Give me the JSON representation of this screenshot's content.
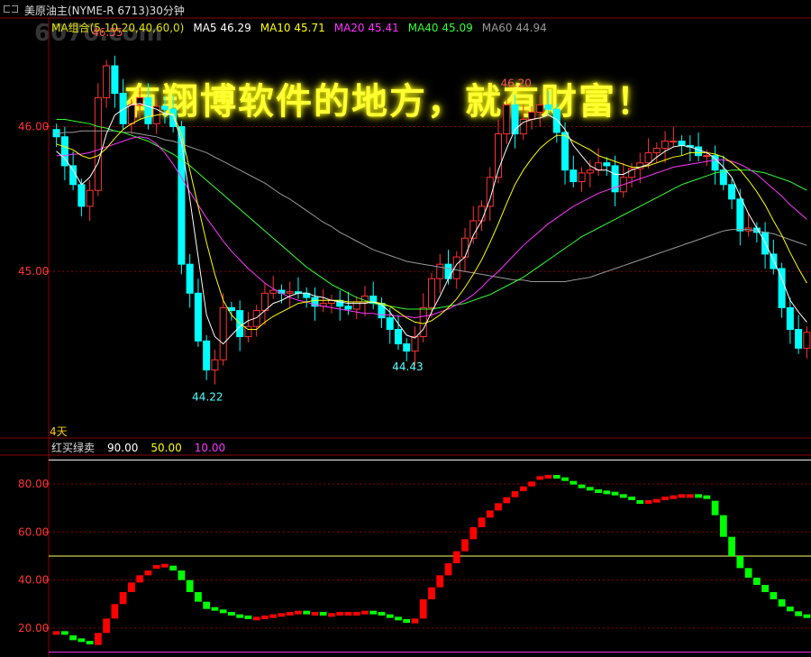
{
  "title": "美原油主(NYME-R 6713)30分钟",
  "watermark": "6070.com",
  "slogan": "有翔博软件的地方，就有财富！",
  "timeframe_label": "4天",
  "ma_legend": [
    {
      "text": "MA组合(5,10,20,40,60,0)",
      "color": "#e0e000"
    },
    {
      "text": "MA5 46.29",
      "color": "#ffffff"
    },
    {
      "text": "MA10 45.71",
      "color": "#ffff00"
    },
    {
      "text": "MA20 45.41",
      "color": "#ff33ff"
    },
    {
      "text": "MA40 45.09",
      "color": "#33ff33"
    },
    {
      "text": "MA60 44.94",
      "color": "#999999"
    }
  ],
  "indicator_legend": [
    {
      "text": "红买绿卖",
      "color": "#dddddd"
    },
    {
      "text": "90.00",
      "color": "#ffffff"
    },
    {
      "text": "50.00",
      "color": "#ffff00"
    },
    {
      "text": "10.00",
      "color": "#ff33ff"
    }
  ],
  "price_axis": {
    "ticks": [
      "46.00",
      "45.00"
    ],
    "ymin": 43.85,
    "ymax": 46.75
  },
  "indicator_axis": {
    "ticks": [
      "80.00",
      "60.00",
      "40.00",
      "20.00"
    ],
    "ymin": 8,
    "ymax": 92
  },
  "annotations": {
    "high1": "46.55",
    "low1": "44.22",
    "high2": "46.20",
    "low2": "44.43"
  },
  "colors": {
    "up": "#ff3232",
    "down": "#00ffff",
    "buy": "#ff0000",
    "sell": "#00ff00",
    "grid": "#8b0000"
  },
  "chart_data": {
    "type": "candlestick",
    "price": {
      "closes": [
        45.93,
        45.73,
        45.6,
        45.45,
        45.56,
        46.2,
        46.42,
        46.23,
        46.02,
        46.15,
        46.2,
        46.02,
        46.14,
        46.12,
        46.0,
        45.05,
        44.85,
        44.52,
        44.32,
        44.39,
        44.75,
        44.73,
        44.55,
        44.62,
        44.73,
        44.85,
        44.87,
        44.85,
        44.86,
        44.85,
        44.82,
        44.76,
        44.78,
        44.8,
        44.76,
        44.74,
        44.79,
        44.83,
        44.78,
        44.68,
        44.6,
        44.5,
        44.45,
        44.55,
        44.75,
        44.95,
        45.05,
        44.95,
        45.1,
        45.23,
        45.35,
        45.45,
        45.65,
        45.95,
        46.15,
        45.95,
        46.05,
        46.1,
        46.15,
        46.12,
        45.96,
        45.7,
        45.62,
        45.68,
        45.7,
        45.75,
        45.73,
        45.55,
        45.65,
        45.71,
        45.75,
        45.82,
        45.85,
        45.9,
        45.9,
        45.87,
        45.86,
        45.8,
        45.8,
        45.7,
        45.6,
        45.5,
        45.28,
        45.3,
        45.27,
        45.12,
        45.02,
        44.75,
        44.6,
        44.47,
        44.58
      ],
      "ma5": [
        45.83,
        45.78,
        45.7,
        45.6,
        45.65,
        45.75,
        45.95,
        46.08,
        46.12,
        46.15,
        46.16,
        46.14,
        46.12,
        46.09,
        46.08,
        45.9,
        45.5,
        45.1,
        44.7,
        44.55,
        44.5,
        44.56,
        44.62,
        44.66,
        44.68,
        44.73,
        44.78,
        44.8,
        44.83,
        44.85,
        44.85,
        44.83,
        44.82,
        44.8,
        44.79,
        44.78,
        44.78,
        44.78,
        44.79,
        44.77,
        44.72,
        44.64,
        44.56,
        44.54,
        44.6,
        44.72,
        44.83,
        44.95,
        45.05,
        45.1,
        45.25,
        45.35,
        45.5,
        45.7,
        45.85,
        45.98,
        46.03,
        46.05,
        46.06,
        46.08,
        46.05,
        45.98,
        45.87,
        45.8,
        45.73,
        45.7,
        45.7,
        45.67,
        45.67,
        45.7,
        45.72,
        45.74,
        45.79,
        45.83,
        45.86,
        45.87,
        45.86,
        45.84,
        45.82,
        45.78,
        45.72,
        45.65,
        45.52,
        45.4,
        45.3,
        45.2,
        45.08,
        44.95,
        44.8,
        44.72,
        44.65
      ],
      "ma10": [
        45.88,
        45.86,
        45.84,
        45.8,
        45.78,
        45.8,
        45.85,
        45.92,
        45.98,
        46.02,
        46.05,
        46.07,
        46.08,
        46.09,
        46.09,
        45.95,
        45.7,
        45.45,
        45.2,
        44.98,
        44.8,
        44.7,
        44.64,
        44.6,
        44.6,
        44.65,
        44.69,
        44.72,
        44.75,
        44.78,
        44.79,
        44.8,
        44.8,
        44.8,
        44.8,
        44.79,
        44.79,
        44.79,
        44.79,
        44.78,
        44.76,
        44.72,
        44.68,
        44.65,
        44.64,
        44.66,
        44.7,
        44.75,
        44.81,
        44.89,
        44.98,
        45.08,
        45.2,
        45.33,
        45.47,
        45.6,
        45.7,
        45.78,
        45.85,
        45.9,
        45.94,
        45.94,
        45.9,
        45.87,
        45.84,
        45.8,
        45.78,
        45.76,
        45.74,
        45.72,
        45.72,
        45.73,
        45.75,
        45.77,
        45.79,
        45.8,
        45.82,
        45.82,
        45.82,
        45.81,
        45.79,
        45.75,
        45.7,
        45.63,
        45.55,
        45.46,
        45.35,
        45.25,
        45.13,
        45.02,
        44.92
      ],
      "ma20": [
        45.8,
        45.8,
        45.81,
        45.81,
        45.82,
        45.84,
        45.86,
        45.88,
        45.9,
        45.92,
        45.93,
        45.92,
        45.88,
        45.82,
        45.74,
        45.65,
        45.55,
        45.46,
        45.37,
        45.29,
        45.21,
        45.14,
        45.08,
        45.02,
        44.97,
        44.92,
        44.88,
        44.85,
        44.82,
        44.8,
        44.79,
        44.77,
        44.76,
        44.75,
        44.74,
        44.73,
        44.72,
        44.71,
        44.71,
        44.7,
        44.7,
        44.69,
        44.69,
        44.68,
        44.69,
        44.7,
        44.72,
        44.74,
        44.77,
        44.8,
        44.84,
        44.89,
        44.95,
        45.0,
        45.06,
        45.12,
        45.18,
        45.23,
        45.28,
        45.33,
        45.37,
        45.41,
        45.45,
        45.48,
        45.51,
        45.54,
        45.56,
        45.58,
        45.6,
        45.62,
        45.64,
        45.66,
        45.68,
        45.7,
        45.72,
        45.73,
        45.74,
        45.75,
        45.76,
        45.77,
        45.77,
        45.76,
        45.74,
        45.71,
        45.67,
        45.62,
        45.57,
        45.52,
        45.46,
        45.41,
        45.36
      ],
      "ma40": [
        46.05,
        46.05,
        46.04,
        46.03,
        46.02,
        46.0,
        45.99,
        45.97,
        45.96,
        45.94,
        45.92,
        45.9,
        45.87,
        45.84,
        45.81,
        45.77,
        45.73,
        45.68,
        45.63,
        45.58,
        45.53,
        45.48,
        45.43,
        45.38,
        45.33,
        45.28,
        45.23,
        45.18,
        45.13,
        45.08,
        45.03,
        44.99,
        44.95,
        44.91,
        44.88,
        44.85,
        44.82,
        44.8,
        44.78,
        44.77,
        44.76,
        44.75,
        44.74,
        44.74,
        44.74,
        44.74,
        44.75,
        44.76,
        44.77,
        44.78,
        44.8,
        44.82,
        44.84,
        44.87,
        44.9,
        44.93,
        44.96,
        45.0,
        45.04,
        45.08,
        45.12,
        45.16,
        45.2,
        45.24,
        45.27,
        45.3,
        45.33,
        45.36,
        45.39,
        45.42,
        45.45,
        45.48,
        45.51,
        45.54,
        45.57,
        45.6,
        45.62,
        45.64,
        45.66,
        45.68,
        45.69,
        45.7,
        45.7,
        45.7,
        45.69,
        45.68,
        45.66,
        45.64,
        45.62,
        45.59,
        45.56
      ],
      "ma60": [
        45.95,
        45.96,
        45.96,
        45.97,
        45.97,
        45.97,
        45.97,
        45.97,
        45.96,
        45.96,
        45.95,
        45.94,
        45.93,
        45.91,
        45.9,
        45.88,
        45.86,
        45.84,
        45.82,
        45.79,
        45.76,
        45.73,
        45.7,
        45.67,
        45.64,
        45.61,
        45.57,
        45.53,
        45.5,
        45.46,
        45.42,
        45.38,
        45.34,
        45.31,
        45.27,
        45.24,
        45.21,
        45.18,
        45.15,
        45.13,
        45.11,
        45.09,
        45.07,
        45.06,
        45.05,
        45.04,
        45.03,
        45.02,
        45.01,
        45.0,
        44.99,
        44.98,
        44.97,
        44.96,
        44.95,
        44.94,
        44.94,
        44.93,
        44.93,
        44.93,
        44.93,
        44.93,
        44.94,
        44.95,
        44.96,
        44.98,
        45.0,
        45.02,
        45.04,
        45.06,
        45.08,
        45.1,
        45.12,
        45.14,
        45.16,
        45.18,
        45.2,
        45.22,
        45.24,
        45.26,
        45.28,
        45.29,
        45.29,
        45.29,
        45.28,
        45.27,
        45.26,
        45.24,
        45.22,
        45.2,
        45.18
      ]
    },
    "indicator": {
      "values": [
        18,
        17,
        15,
        14,
        13,
        18,
        24,
        30,
        35,
        39,
        42,
        44,
        45.5,
        46,
        44,
        40,
        35,
        31,
        28,
        27,
        26,
        25,
        24.5,
        24,
        24,
        24.5,
        25,
        25.5,
        26,
        26.5,
        26,
        26,
        25.5,
        25.5,
        26,
        26,
        26,
        26.5,
        26,
        25,
        24,
        23,
        22,
        24,
        32,
        37,
        42,
        47,
        52,
        57,
        62,
        66,
        69,
        72,
        74.5,
        77,
        79,
        81,
        82.5,
        83,
        82,
        80.5,
        79,
        78,
        77,
        76.5,
        76,
        75,
        74,
        72.5,
        72,
        72.5,
        73,
        74,
        74.5,
        75,
        75,
        74.5,
        73,
        67,
        58,
        50,
        45,
        41,
        38,
        35,
        32,
        29,
        27,
        25,
        24
      ],
      "lines": {
        "upper": 90,
        "mid": 50,
        "lower": 10
      }
    }
  }
}
